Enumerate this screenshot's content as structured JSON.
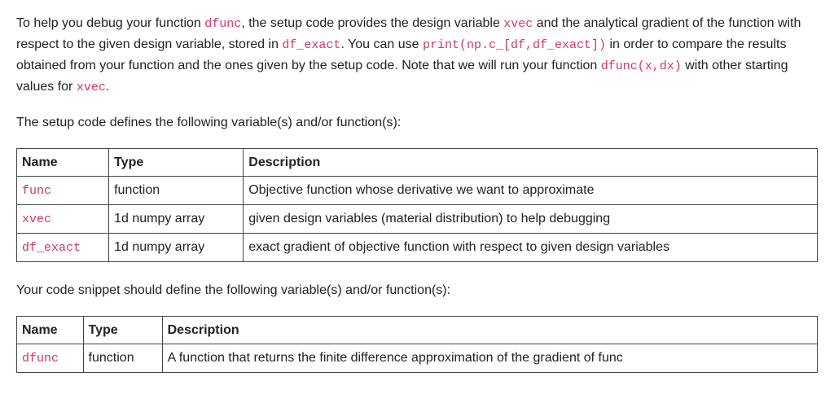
{
  "intro": {
    "part1": "To help you debug your function ",
    "code1": "dfunc",
    "part2": ", the setup code provides the design variable ",
    "code2": "xvec",
    "part3": " and the analytical gradient of the function with respect to the given design variable, stored in ",
    "code3": "df_exact",
    "part4": ". You can use ",
    "code4": "print(np.c_[df,df_exact])",
    "part5": " in order to compare the results obtained from your function and the ones given by the setup code. Note that we will run your function ",
    "code5": "dfunc(x,dx)",
    "part6": " with other starting values for ",
    "code6": "xvec",
    "part7": "."
  },
  "setup_intro": "The setup code defines the following variable(s) and/or function(s):",
  "table1_headers": {
    "name": "Name",
    "type": "Type",
    "description": "Description"
  },
  "table1_rows": [
    {
      "name": "func",
      "type": "function",
      "description": "Objective function whose derivative we want to approximate"
    },
    {
      "name": "xvec",
      "type": "1d numpy array",
      "description": "given design variables (material distribution) to help debugging"
    },
    {
      "name": "df_exact",
      "type": "1d numpy array",
      "description": "exact gradient of objective function with respect to given design variables"
    }
  ],
  "snippet_intro": "Your code snippet should define the following variable(s) and/or function(s):",
  "table2_headers": {
    "name": "Name",
    "type": "Type",
    "description": "Description"
  },
  "table2_rows": [
    {
      "name": "dfunc",
      "type": "function",
      "description": "A function that returns the finite difference approximation of the gradient of func"
    }
  ]
}
